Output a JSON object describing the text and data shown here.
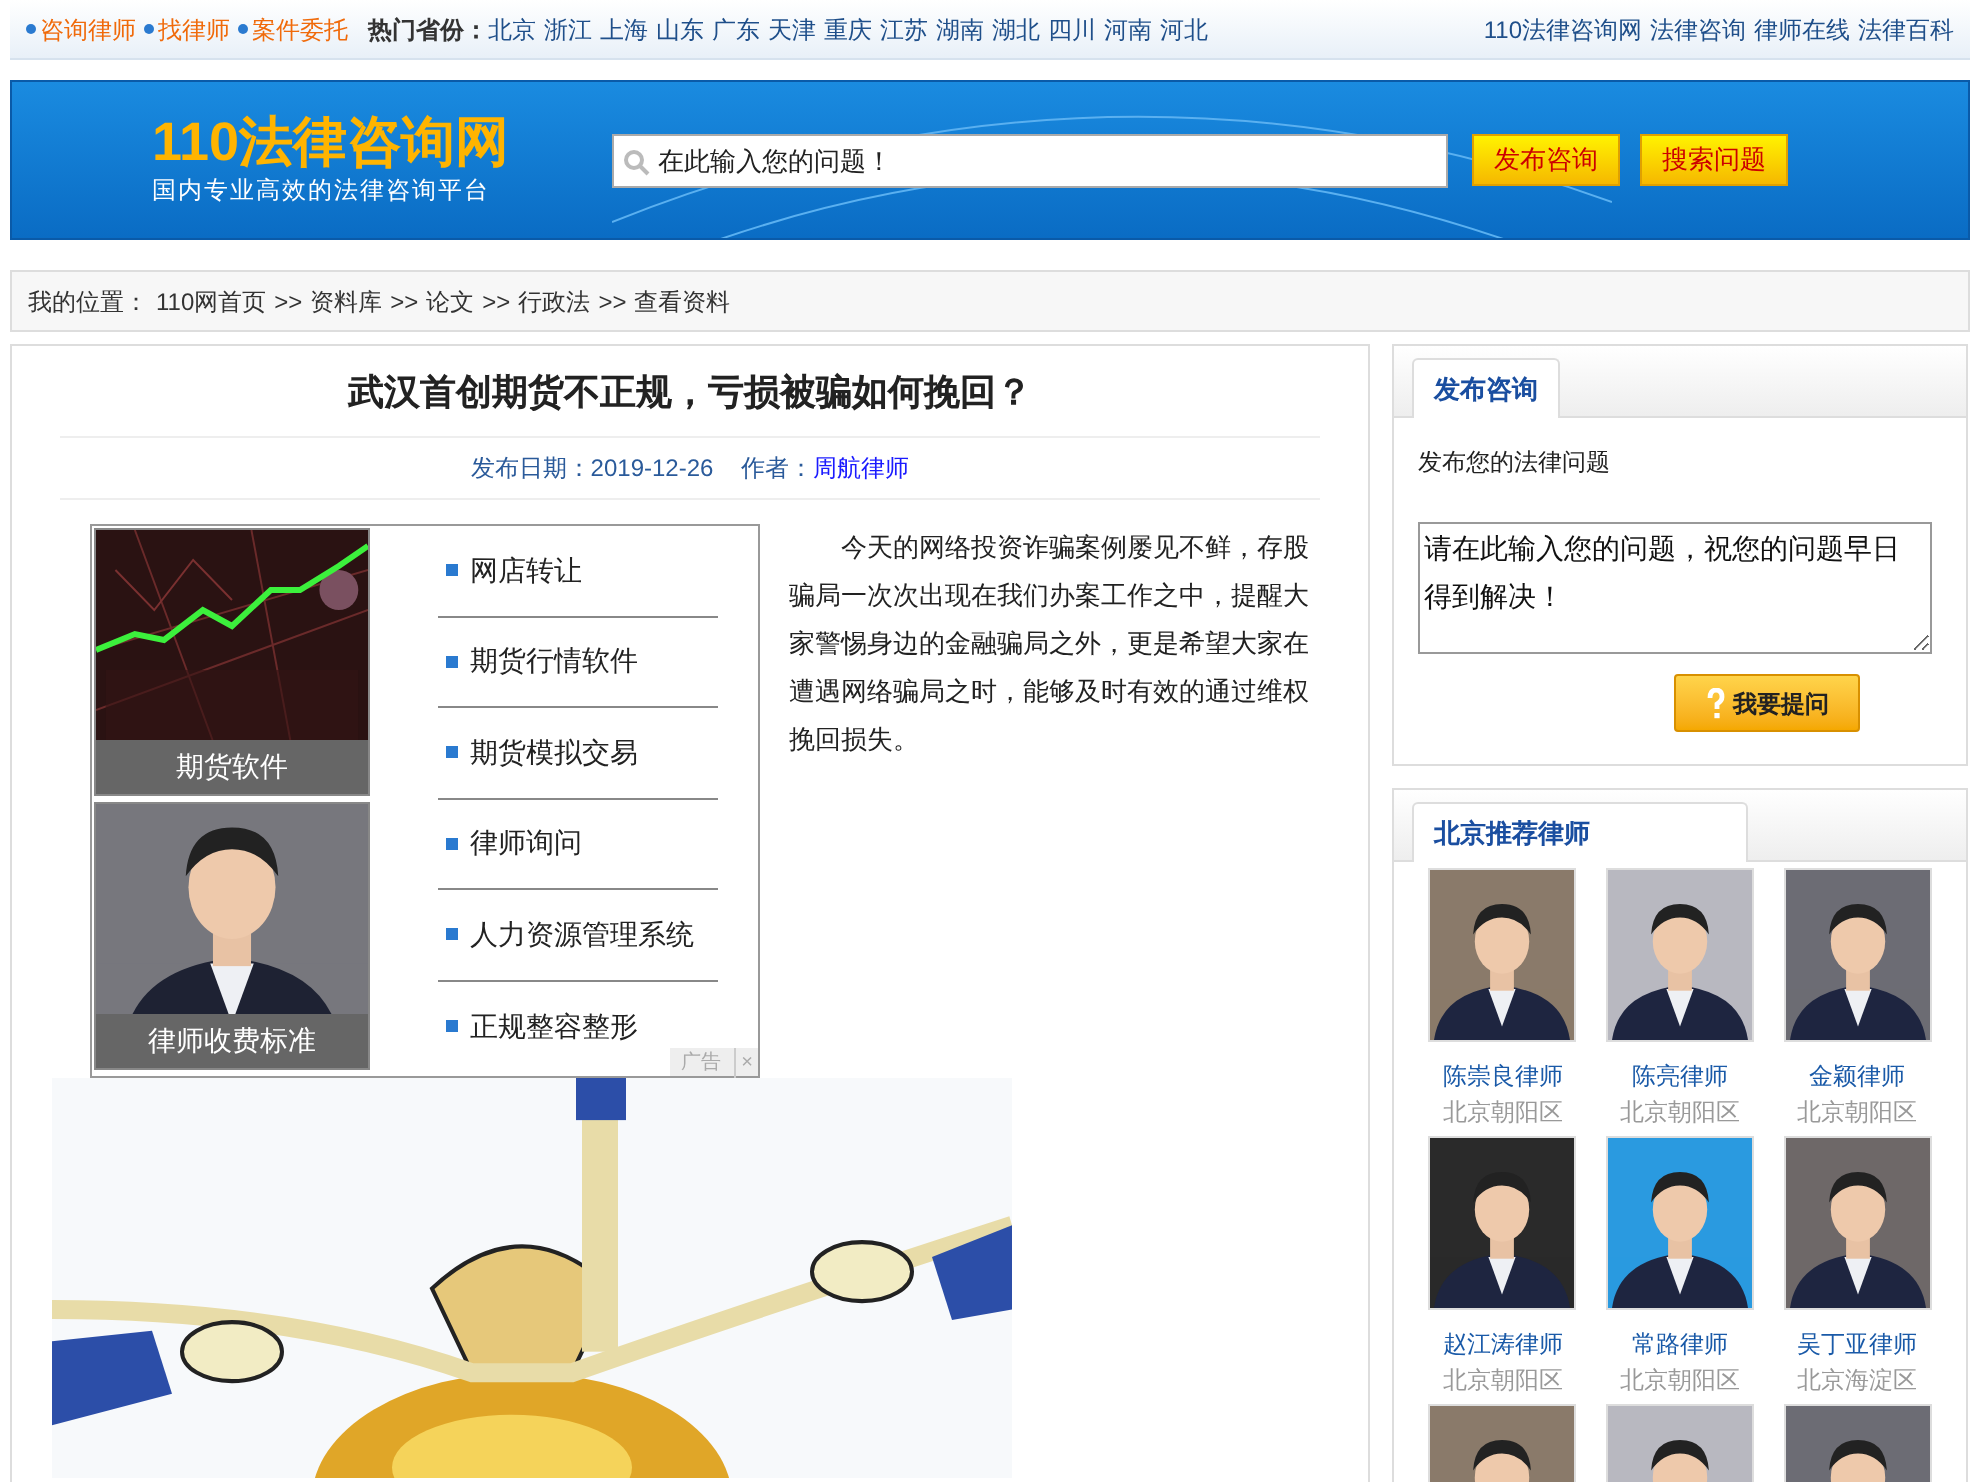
{
  "top_bar": {
    "quick_links": [
      "咨询律师",
      "找律师",
      "案件委托"
    ],
    "provinces_label": "热门省份：",
    "provinces": [
      "北京",
      "浙江",
      "上海",
      "山东",
      "广东",
      "天津",
      "重庆",
      "江苏",
      "湖南",
      "湖北",
      "四川",
      "河南",
      "河北"
    ],
    "site_links": [
      "110法律咨询网",
      "法律咨询",
      "律师在线",
      "法律百科"
    ]
  },
  "header": {
    "logo": "110法律咨询网",
    "slogan": "国内专业高效的法律咨询平台",
    "search": {
      "placeholder": "在此输入您的问题！"
    },
    "buttons": [
      "发布咨询",
      "搜索问题"
    ]
  },
  "breadcrumb": {
    "label": "我的位置：",
    "items": [
      "110网首页",
      "资料库",
      "论文",
      "行政法",
      "查看资料"
    ],
    "separator": ">>"
  },
  "article": {
    "title": "武汉首创期货不正规，亏损被骗如何挽回？",
    "date_label": "发布日期：",
    "date": "2019-12-26",
    "author_label": "作者：",
    "author": "周航律师",
    "ad": {
      "tiles": [
        {
          "caption": "期货软件",
          "kind": "chart"
        },
        {
          "caption": "律师收费标准",
          "kind": "person"
        }
      ],
      "links": [
        "网店转让",
        "期货行情软件",
        "期货模拟交易",
        "律师询问",
        "人力资源管理系统",
        "正规整容整形"
      ],
      "badge": "广告",
      "close": "×"
    },
    "paragraph": "今天的网络投资诈骗案例屡见不鲜，存股骗局一次次出现在我们办案工作之中，提醒大家警惕身边的金融骗局之外，更是希望大家在遭遇网络骗局之时，能够及时有效的通过维权挽回损失。"
  },
  "consult": {
    "tab": "发布咨询",
    "subtitle": "发布您的法律问题",
    "textarea": "请在此输入您的问题，祝您的问题早日得到解决！",
    "button": "我要提问"
  },
  "lawyers": {
    "tab": "北京推荐律师",
    "items": [
      {
        "name": "陈崇良律师",
        "district": "北京朝阳区"
      },
      {
        "name": "陈亮律师",
        "district": "北京朝阳区"
      },
      {
        "name": "金颖律师",
        "district": "北京朝阳区"
      },
      {
        "name": "赵江涛律师",
        "district": "北京朝阳区"
      },
      {
        "name": "常路律师",
        "district": "北京朝阳区"
      },
      {
        "name": "吴丁亚律师",
        "district": "北京海淀区"
      }
    ]
  }
}
